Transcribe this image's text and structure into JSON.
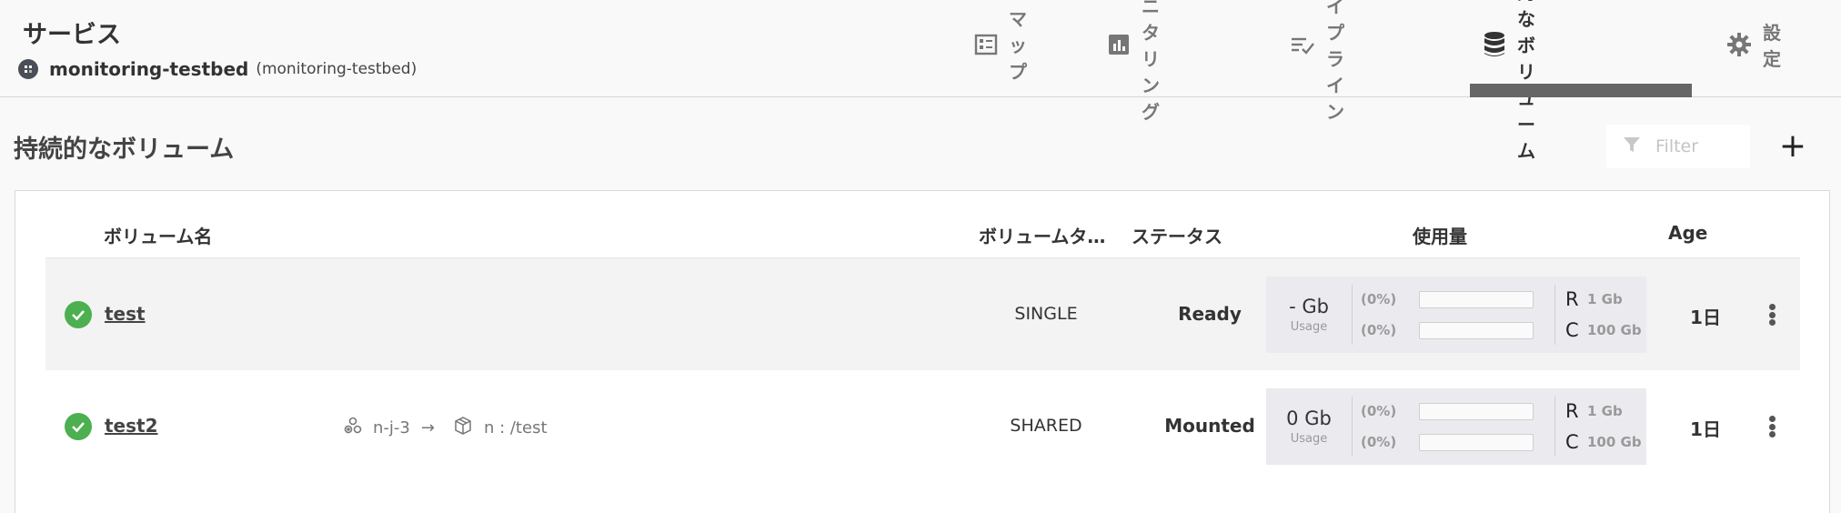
{
  "header": {
    "title": "サービス",
    "service_name": "monitoring-testbed",
    "service_id": "(monitoring-testbed)"
  },
  "tabs": [
    {
      "label": "マップ",
      "icon": "map-icon"
    },
    {
      "label": "モニタリング",
      "icon": "bar-chart-icon"
    },
    {
      "label": "パイプライン",
      "icon": "pipeline-icon"
    },
    {
      "label": "持続的なボリューム",
      "icon": "database-icon",
      "active": true
    },
    {
      "label": "設定",
      "icon": "gear-icon"
    }
  ],
  "page": {
    "title": "持続的なボリューム",
    "filter_placeholder": "Filter",
    "add_label": "+"
  },
  "table": {
    "columns": {
      "name": "ボリューム名",
      "type": "ボリュームタ…",
      "status": "ステータス",
      "usage": "使用量",
      "age": "Age"
    },
    "rows": [
      {
        "name": "test",
        "node": "",
        "mount": "",
        "type": "SINGLE",
        "status": "Ready",
        "usage_value": "- Gb",
        "usage_label": "Usage",
        "r_pct": "(0%)",
        "c_pct": "(0%)",
        "r_fill": 0,
        "c_fill": 0,
        "r_key": "R",
        "r_val": "1 Gb",
        "c_key": "C",
        "c_val": "100 Gb",
        "age": "1日"
      },
      {
        "name": "test2",
        "node": "n-j-3",
        "arrow": "→",
        "mount": "n : /test",
        "type": "SHARED",
        "status": "Mounted",
        "usage_value": "0 Gb",
        "usage_label": "Usage",
        "r_pct": "(0%)",
        "c_pct": "(0%)",
        "r_fill": 0,
        "c_fill": 0,
        "r_key": "R",
        "r_val": "1 Gb",
        "c_key": "C",
        "c_val": "100 Gb",
        "age": "1日"
      }
    ]
  },
  "colors": {
    "status_ok": "#4caf50",
    "active_tab_underline": "#666666"
  }
}
